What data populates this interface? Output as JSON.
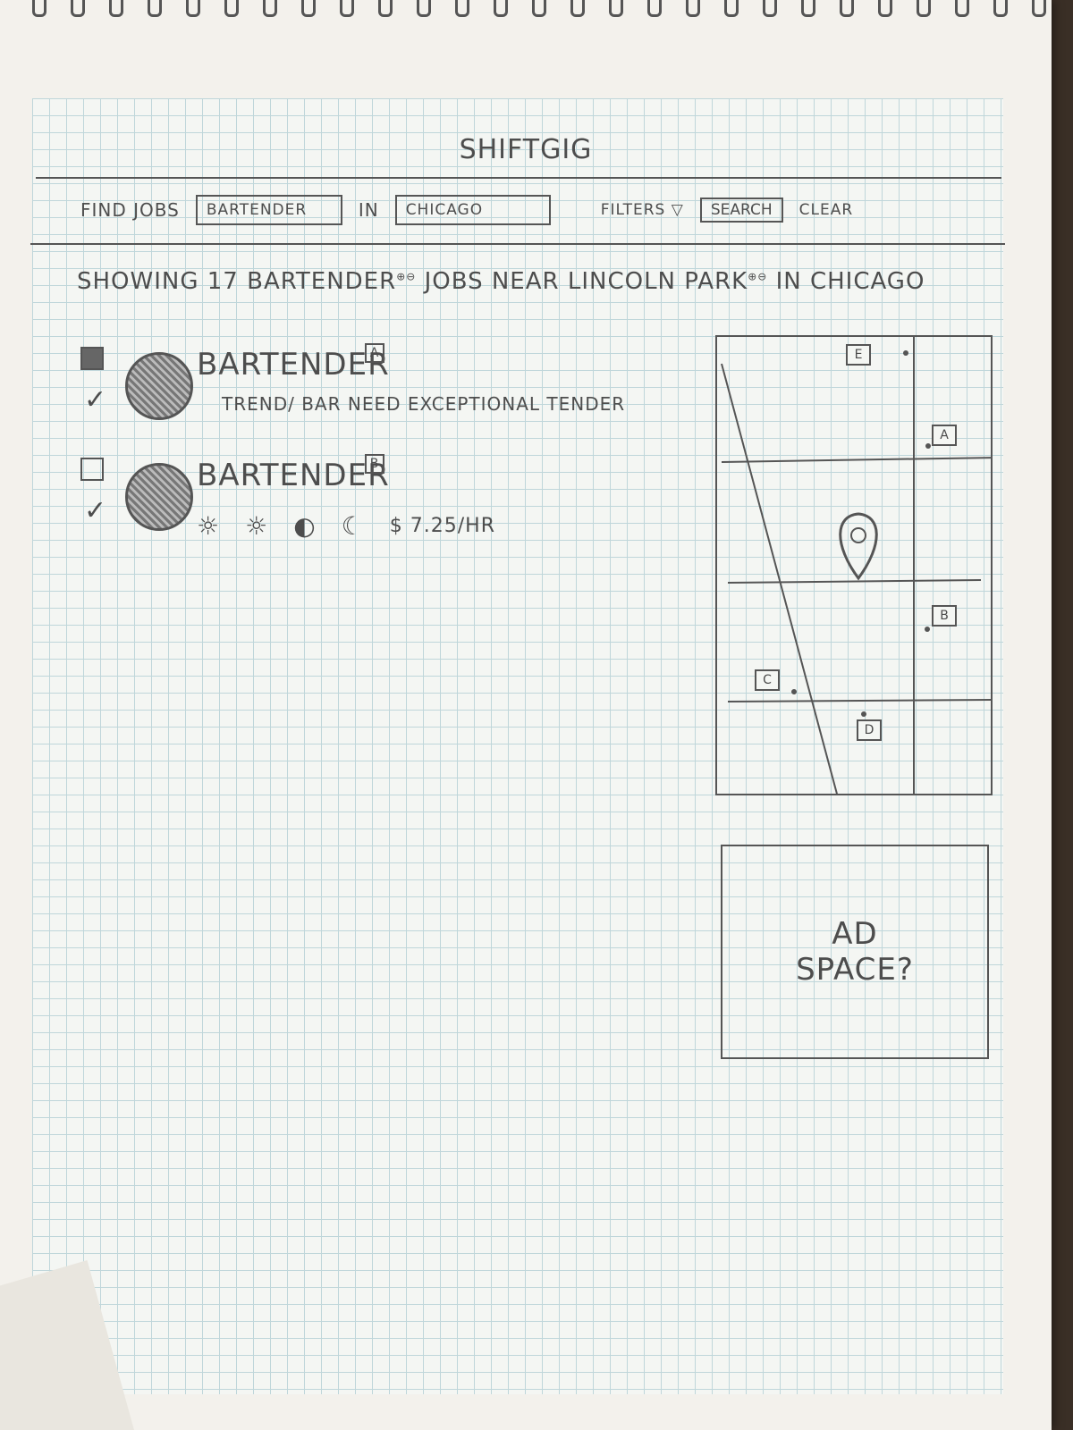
{
  "app": {
    "brand": "Shiftgig"
  },
  "search": {
    "find_label": "Find Jobs",
    "what_value": "Bartender",
    "in_label": "in",
    "where_value": "Chicago",
    "filters_label": "Filters ▽",
    "search_label": "Search",
    "clear_label": "Clear"
  },
  "results": {
    "summary_prefix": "Showing 17",
    "role": "Bartender",
    "summary_middle": "jobs near",
    "neighborhood": "Lincoln Park",
    "summary_in": "in",
    "city": "Chicago"
  },
  "jobs": [
    {
      "title": "Bartender",
      "marker": "A",
      "description": "Trend/ bar need exceptional tender",
      "saved": true
    },
    {
      "title": "Bartender",
      "marker": "B",
      "shifts": [
        "☼",
        "☼",
        "◐",
        "☾"
      ],
      "wage": "$ 7.25/hr",
      "saved": false
    }
  ],
  "map": {
    "pins": [
      "E",
      "A",
      "B",
      "C",
      "D"
    ],
    "center_pin": "O"
  },
  "ad": {
    "line1": "Ad",
    "line2": "Space?"
  },
  "colors": {
    "pencil": "#4d4d4d",
    "grid": "#bfd6da",
    "paper": "#f4f6f3"
  }
}
